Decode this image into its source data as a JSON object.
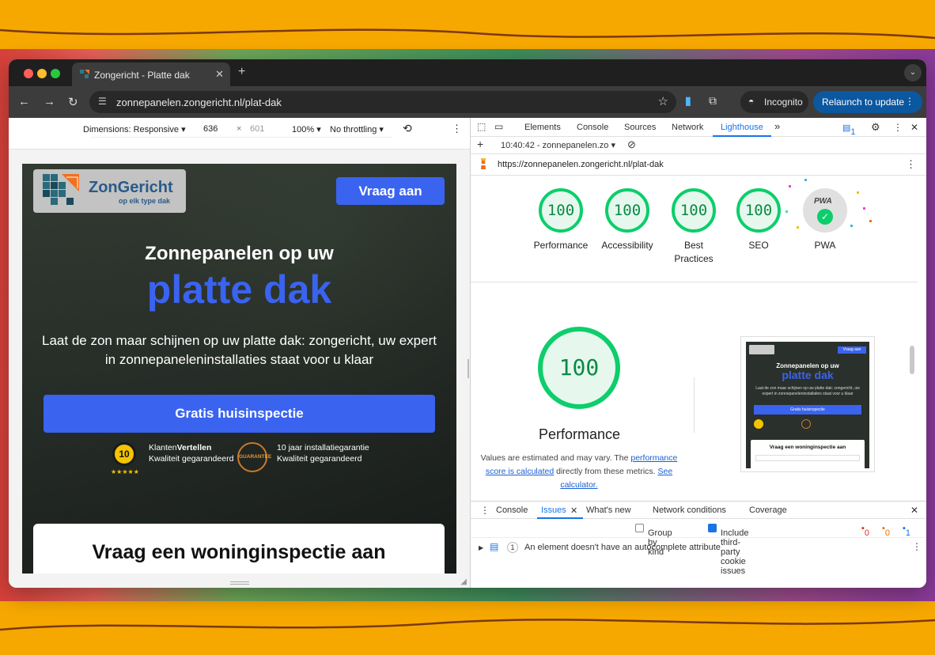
{
  "colors": {
    "accent": "#3a63f0",
    "score_green": "#0cce6b",
    "devtools_blue": "#1a73e8"
  },
  "browser": {
    "tab_title": "Zongericht - Platte dak",
    "url": "zonnepanelen.zongericht.nl/plat-dak",
    "incognito_label": "Incognito",
    "relaunch_label": "Relaunch to update"
  },
  "device_toolbar": {
    "dimensions_label": "Dimensions: Responsive ▾",
    "width": "636",
    "times": "×",
    "height": "601",
    "zoom": "100% ▾",
    "throttling": "No throttling ▾"
  },
  "site": {
    "logo_name": "ZonGericht",
    "logo_tagline": "op elk type dak",
    "cta_top": "Vraag aan",
    "heading_line1": "Zonnepanelen op uw",
    "heading_line2": "platte dak",
    "subtitle": "Laat de zon maar schijnen op uw platte dak: zongericht, uw expert in zonnepaneleninstallaties staat voor u klaar",
    "cta_main": "Gratis huisinspectie",
    "badge1_score": "10",
    "badge1_line1a": "Klanten",
    "badge1_line1b": "Vertellen",
    "badge1_line2": "Kwaliteit gegarandeerd",
    "badge1_stars": "★★★★★",
    "badge2_seal": "GUARANTEE",
    "badge2_line1": "10 jaar installatiegarantie",
    "badge2_line2": "Kwaliteit gegarandeerd",
    "form_title": "Vraag een woninginspectie aan"
  },
  "devtools": {
    "tabs": [
      "Elements",
      "Console",
      "Sources",
      "Network",
      "Lighthouse"
    ],
    "more_tabs": "»",
    "issues_count": "1",
    "report_time": "10:40:42 - zonnepanelen.zo ▾",
    "report_url": "https://zonnepanelen.zongericht.nl/plat-dak",
    "scores": [
      {
        "label": "Performance",
        "value": "100"
      },
      {
        "label": "Accessibility",
        "value": "100"
      },
      {
        "label": "Best Practices",
        "value": "100"
      },
      {
        "label": "SEO",
        "value": "100"
      }
    ],
    "pwa_label": "PWA",
    "pwa_badge": "PWA",
    "perf_score": "100",
    "perf_title": "Performance",
    "note_prefix": "Values are estimated and may vary. The ",
    "note_link1": "performance score is calculated",
    "note_mid": " directly from these metrics. ",
    "note_link2": "See calculator.",
    "thumb_cta": "Vraag aan",
    "thumb_h1": "Zonnepanelen op uw",
    "thumb_h2": "platte dak",
    "thumb_sub": "Laat de zon maar schijnen op uw platte dak: zongericht, uw expert in zonnepaneleninstallaties staat voor u klaar",
    "thumb_btn": "Gratis huisinspectie",
    "thumb_form": "Vraag een woninginspectie aan",
    "drawer_tabs": [
      "Console",
      "Issues",
      "What's new",
      "Network conditions",
      "Coverage"
    ],
    "group_by_kind": "Group by kind",
    "third_party": "Include third-party cookie issues",
    "count_red": "0",
    "count_orange": "0",
    "count_blue": "1",
    "issue_count": "1",
    "issue_text": "An element doesn't have an autocomplete attribute"
  }
}
